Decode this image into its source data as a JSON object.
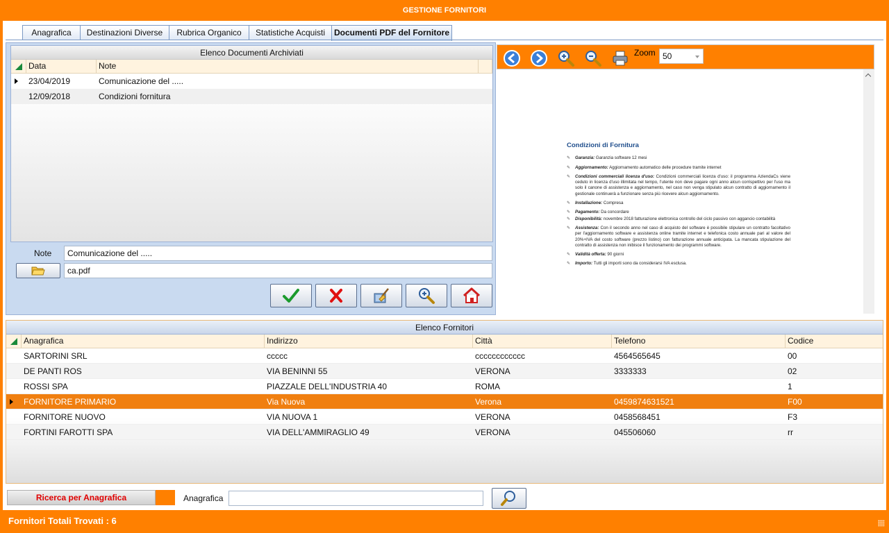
{
  "window": {
    "title": "GESTIONE FORNITORI"
  },
  "tabs": [
    {
      "label": "Anagrafica"
    },
    {
      "label": "Destinazioni Diverse"
    },
    {
      "label": "Rubrica Organico"
    },
    {
      "label": "Statistiche Acquisti"
    },
    {
      "label": "Documenti PDF del Fornitore"
    }
  ],
  "documents": {
    "caption": "Elenco Documenti Archiviati",
    "columns": [
      "Data",
      "Note"
    ],
    "rows": [
      {
        "data": "23/04/2019",
        "note": "Comunicazione del ....."
      },
      {
        "data": "12/09/2018",
        "note": "Condizioni fornitura"
      }
    ],
    "note_label": "Note",
    "note_value": "Comunicazione del .....",
    "file_value": "ca.pdf"
  },
  "toolbar_icons": {
    "confirm": "check-icon",
    "cancel": "x-icon",
    "clear": "broom-icon",
    "view": "magnifier-icon",
    "home": "house-icon",
    "browse": "folder-icon"
  },
  "pdf": {
    "zoom_label": "Zoom",
    "zoom_value": "50",
    "doc_title": "Condizioni di Fornitura",
    "items": [
      {
        "k": "Garanzia:",
        "v": " Garanzia software 12 mesi"
      },
      {
        "k": "Aggiornamento:",
        "v": " Aggiornamento automatico delle procedure tramite internet"
      },
      {
        "k": "Condizioni commerciali licenza d'uso:",
        "v": " Condizioni commerciali licenza d'uso: il programma AziendaCs viene ceduto in licenza d'uso illimitata nel tempo, l'utente non deve pagare ogni anno alcun corrispettivo per l'uso ma solo il canone di assistenza e aggiornamento, nel caso non venga stipulato alcun contratto di aggiornamento il gestionale continuerà a funzionare senza più ricevere alcun aggiornamento."
      },
      {
        "k": "Installazione:",
        "v": " Compresa"
      },
      {
        "k": "Pagamento:",
        "v": " Da concordare"
      },
      {
        "k": "Disponibilità:",
        "v": " novembre 2018 fatturazione elettronica controllo del ciclo passivo con aggancio contabilità"
      },
      {
        "k": "Assistenza:",
        "v": " Con il secondo anno nel caso di acquisto del software è possibile stipulare un contratto facoltativo per l'aggiornamento software e assistenza online tramite internet e telefonica costo annuale pari al valore del 20%+IVA del costo software (prezzo listino) con fatturazione annuale anticipata. La mancata stipulazione del contratto di assistenza non inibisce il funzionamento dei programmi software."
      },
      {
        "k": "Validità offerta:",
        "v": " 90 giorni"
      },
      {
        "k": "Importo:",
        "v": " Tutti gli importi sono da considerarsi IVA esclusa."
      }
    ]
  },
  "suppliers": {
    "caption": "Elenco Fornitori",
    "columns": [
      "Anagrafica",
      "Indirizzo",
      "Città",
      "Telefono",
      "Codice"
    ],
    "rows": [
      {
        "anagrafica": "SARTORINI SRL",
        "indirizzo": "ccccc",
        "citta": "cccccccccccc",
        "telefono": "4564565645",
        "codice": "00"
      },
      {
        "anagrafica": "DE PANTI ROS",
        "indirizzo": "VIA BENINNI 55",
        "citta": "VERONA",
        "telefono": "3333333",
        "codice": "02"
      },
      {
        "anagrafica": "ROSSI SPA",
        "indirizzo": "PIAZZALE DELL'INDUSTRIA 40",
        "citta": "ROMA",
        "telefono": "",
        "codice": "1"
      },
      {
        "anagrafica": "FORNITORE PRIMARIO",
        "indirizzo": "Via Nuova",
        "citta": "Verona",
        "telefono": "0459874631521",
        "codice": "F00"
      },
      {
        "anagrafica": "FORNITORE NUOVO",
        "indirizzo": "VIA NUOVA 1",
        "citta": "VERONA",
        "telefono": "0458568451",
        "codice": "F3"
      },
      {
        "anagrafica": "FORTINI FAROTTI SPA",
        "indirizzo": "VIA DELL'AMMIRAGLIO 49",
        "citta": "VERONA",
        "telefono": "045506060",
        "codice": "rr"
      }
    ]
  },
  "search": {
    "mode_label": "Ricerca per Anagrafica",
    "field_label": "Anagrafica",
    "field_value": ""
  },
  "status": {
    "text": "Fornitori Totali Trovati : 6"
  },
  "colors": {
    "accent": "#ff8000",
    "panel": "#c9daf0",
    "selected_row": "#f07f10"
  }
}
